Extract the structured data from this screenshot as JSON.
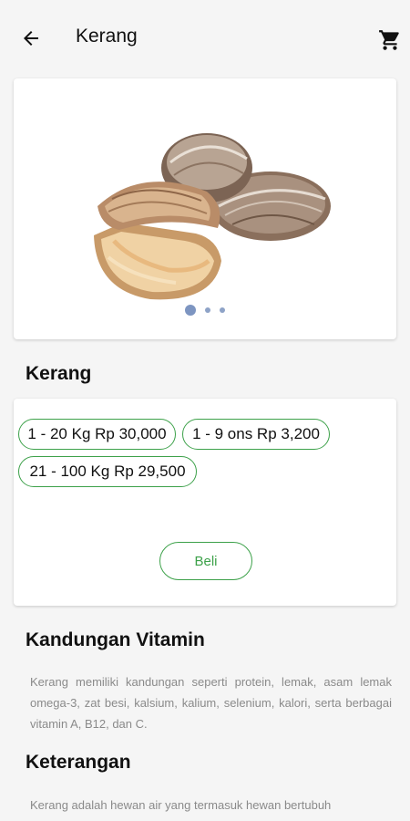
{
  "appbar": {
    "title": "Kerang",
    "back_icon": "arrow-left-icon",
    "cart_icon": "shopping-cart-icon"
  },
  "carousel": {
    "image": "clams-photo",
    "page_count": 3,
    "active_index": 0
  },
  "product": {
    "name": "Kerang"
  },
  "prices": [
    {
      "label": "1 - 20 Kg Rp 30,000"
    },
    {
      "label": "1 - 9 ons Rp 3,200"
    },
    {
      "label": "21 - 100 Kg Rp 29,500"
    }
  ],
  "buy_label": "Beli",
  "vitamin": {
    "title": "Kandungan Vitamin",
    "text": "Kerang memiliki kandungan seperti protein, lemak, asam lemak omega-3, zat besi, kalsium, kalium, selenium, kalori, serta berbagai vitamin A, B12, dan C."
  },
  "description": {
    "title": "Keterangan",
    "text": "Kerang adalah hewan air yang termasuk hewan bertubuh"
  },
  "colors": {
    "accent_green": "#3da14a",
    "dot_blue": "#7d95c1",
    "background": "#f5f5f5"
  }
}
